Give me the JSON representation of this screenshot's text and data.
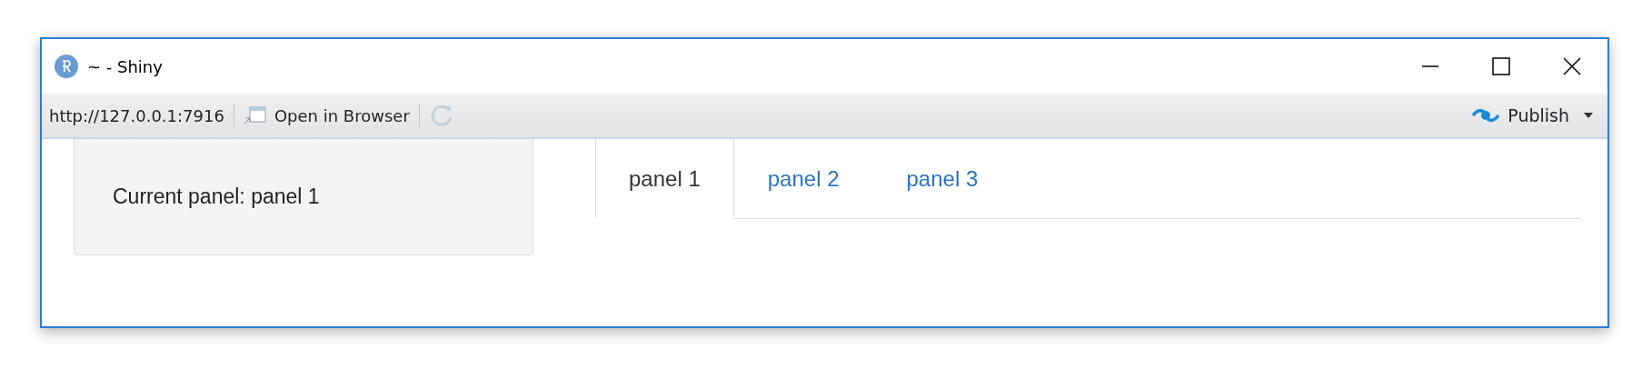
{
  "window": {
    "title": "~ - Shiny"
  },
  "toolbar": {
    "url": "http://127.0.0.1:7916",
    "open_in_browser": "Open in Browser",
    "publish": "Publish"
  },
  "well": {
    "text": "Current panel: panel 1"
  },
  "tabs": [
    {
      "label": "panel 1",
      "selected": true
    },
    {
      "label": "panel 2",
      "selected": false
    },
    {
      "label": "panel 3",
      "selected": false
    }
  ]
}
